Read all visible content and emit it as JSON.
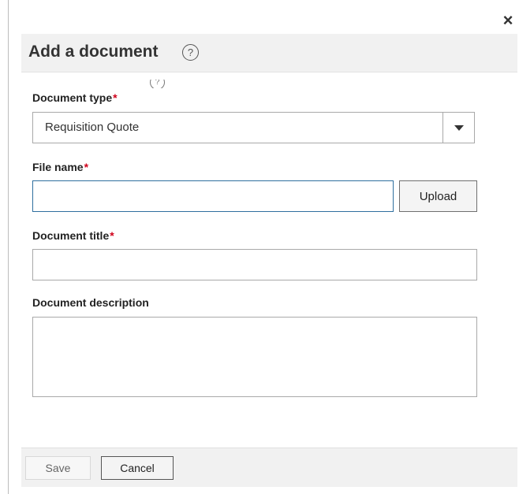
{
  "close": {
    "glyph": "×"
  },
  "dialog": {
    "title": "Add a document",
    "help_glyph": "?"
  },
  "fields": {
    "document_type": {
      "label": "Document type",
      "required_mark": "*",
      "value": "Requisition Quote"
    },
    "file_name": {
      "label": "File name",
      "required_mark": "*",
      "value": "",
      "upload_label": "Upload"
    },
    "document_title": {
      "label": "Document title",
      "required_mark": "*",
      "value": ""
    },
    "document_description": {
      "label": "Document description",
      "value": ""
    }
  },
  "footer": {
    "save_label": "Save",
    "cancel_label": "Cancel"
  },
  "colors": {
    "required": "#d0021b",
    "focus_border": "#2f6f9f",
    "header_bg": "#f1f1f1"
  }
}
